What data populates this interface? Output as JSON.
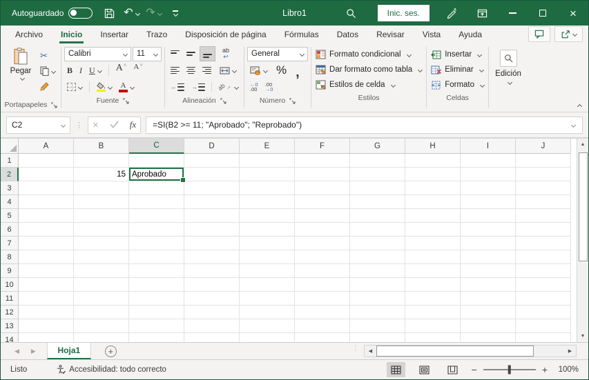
{
  "title_bar": {
    "autosave_label": "Autoguardado",
    "document_title": "Libro1",
    "sign_in_label": "Inic. ses."
  },
  "tabs": {
    "active": "Inicio",
    "items": [
      {
        "label": "Archivo"
      },
      {
        "label": "Inicio"
      },
      {
        "label": "Insertar"
      },
      {
        "label": "Trazo"
      },
      {
        "label": "Disposición de página"
      },
      {
        "label": "Fórmulas"
      },
      {
        "label": "Datos"
      },
      {
        "label": "Revisar"
      },
      {
        "label": "Vista"
      },
      {
        "label": "Ayuda"
      }
    ]
  },
  "ribbon": {
    "clipboard": {
      "group_label": "Portapapeles",
      "paste_label": "Pegar"
    },
    "font": {
      "group_label": "Fuente",
      "font_name": "Calibri",
      "font_size": "11",
      "bold": "B",
      "italic": "I",
      "underline": "U",
      "grow": "A",
      "shrink": "A",
      "color_letter": "A"
    },
    "alignment": {
      "group_label": "Alineación",
      "wrap_ab": "ab",
      "orient_ab": "ab"
    },
    "number": {
      "group_label": "Número",
      "format": "General",
      "percent": "%",
      "comma": ",",
      "inc_top": "←0",
      "inc_bottom": ".00",
      "dec_top": ".00",
      "dec_bottom": "→0"
    },
    "styles": {
      "group_label": "Estilos",
      "conditional_label": "Formato condicional",
      "table_label": "Dar formato como tabla",
      "cellstyles_label": "Estilos de celda"
    },
    "cells": {
      "group_label": "Celdas",
      "insert_label": "Insertar",
      "delete_label": "Eliminar",
      "format_label": "Formato"
    },
    "editing": {
      "label": "Edición"
    }
  },
  "formula_bar": {
    "name_box": "C2",
    "fx_label": "fx",
    "formula": "=SI(B2 >= 11; \"Aprobado\"; \"Reprobado\")"
  },
  "grid": {
    "columns": [
      "A",
      "B",
      "C",
      "D",
      "E",
      "F",
      "G",
      "H",
      "I",
      "J"
    ],
    "row_count": 14,
    "cells": [
      {
        "ref": "B2",
        "value": "15",
        "align": "right"
      },
      {
        "ref": "C2",
        "value": "Aprobado",
        "align": "left"
      }
    ],
    "selected": {
      "col": "C",
      "row": 2
    }
  },
  "sheet_bar": {
    "sheets": [
      {
        "name": "Hoja1",
        "active": true
      }
    ]
  },
  "status_bar": {
    "mode_label": "Listo",
    "accessibility_label": "Accesibilidad: todo correcto",
    "zoom_label": "100%"
  },
  "icons": {
    "undo": "↶",
    "redo": "↷",
    "scissors": "✂",
    "return_arrow": "↩",
    "close": "×",
    "dots": "⋮",
    "up_arrow": "▲",
    "down_arrow": "▼",
    "left_arrow": "◀",
    "right_arrow": "▶",
    "nav_left": "◀",
    "nav_right": "▶",
    "add_sheet": "+",
    "minus": "−",
    "plus": "+"
  },
  "colors": {
    "title_green": "#1E6B41",
    "accent_green": "#217346",
    "ribbon_bg": "#f4f3f2",
    "fill_yellow": "#FFE812",
    "font_red": "#C00000",
    "icon_blue": "#3A6EA5",
    "icon_orange": "#D07B2C"
  }
}
